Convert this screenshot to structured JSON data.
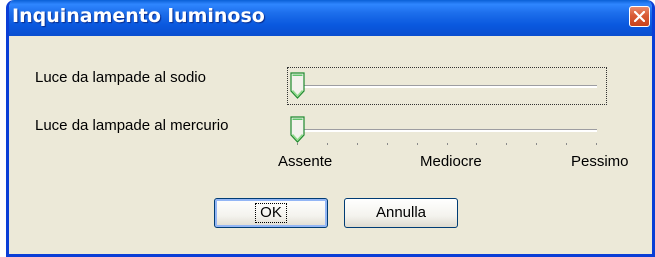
{
  "dialog": {
    "title": "Inquinamento luminoso",
    "close_icon": "close-icon"
  },
  "sliders": [
    {
      "label": "Luce da lampade al sodio",
      "value": 0,
      "focused": true
    },
    {
      "label": "Luce da lampade al mercurio",
      "value": 0,
      "focused": false
    }
  ],
  "scale": {
    "min_label": "Assente",
    "mid_label": "Mediocre",
    "max_label": "Pessimo"
  },
  "buttons": {
    "ok_label": "OK",
    "cancel_label": "Annulla"
  },
  "colors": {
    "titlebar": "#1d6fec",
    "window_bg": "#ece9d8",
    "close_button": "#d95a34",
    "button_border": "#003c74"
  }
}
